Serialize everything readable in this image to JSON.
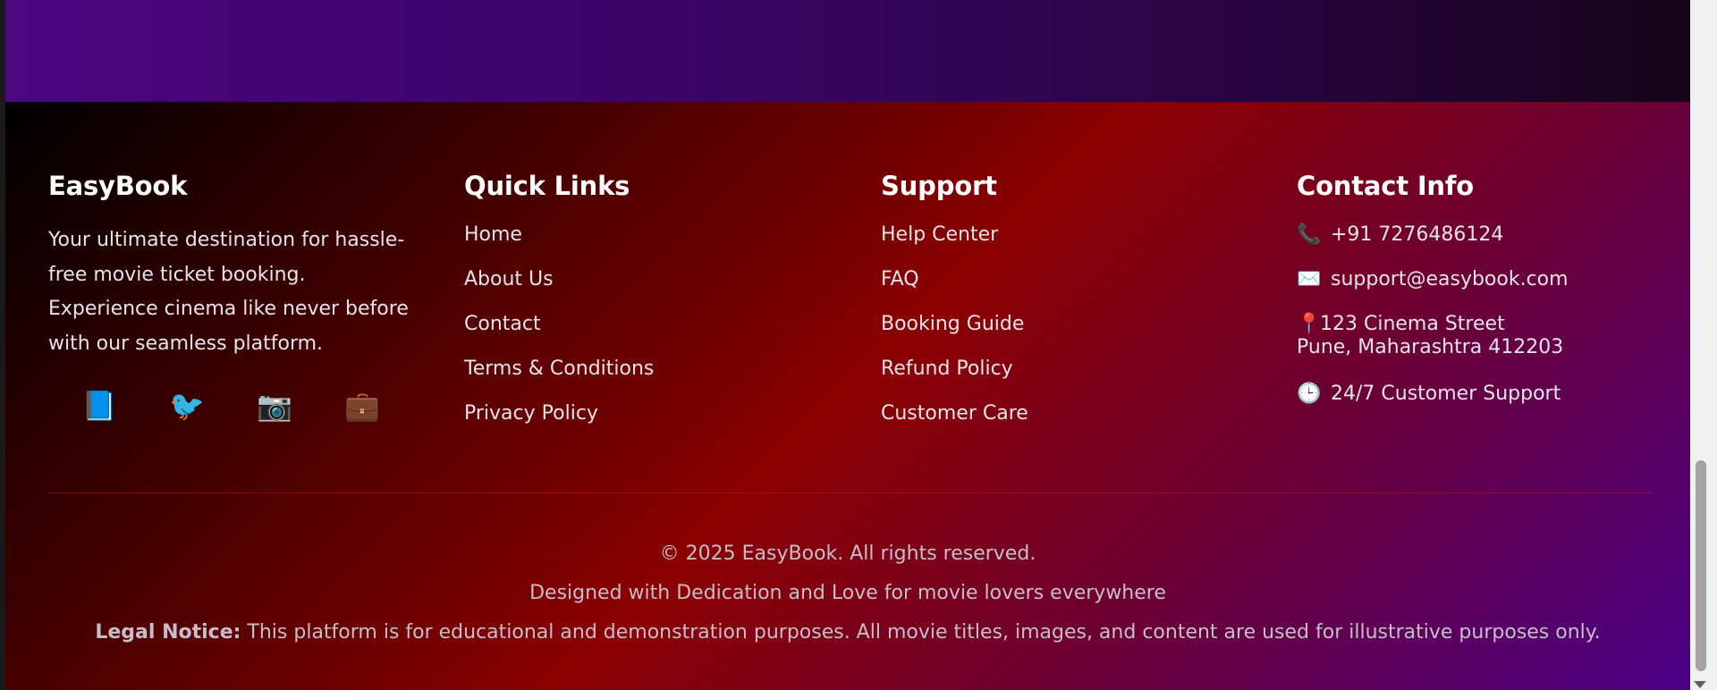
{
  "brand": {
    "title": "EasyBook",
    "description": "Your ultimate destination for hassle-free movie ticket booking. Experience cinema like never before with our seamless platform.",
    "social": [
      {
        "icon": "book-icon",
        "glyph": "📘"
      },
      {
        "icon": "bird-icon",
        "glyph": "🐦"
      },
      {
        "icon": "camera-icon",
        "glyph": "📷"
      },
      {
        "icon": "briefcase-icon",
        "glyph": "💼"
      }
    ]
  },
  "quick_links": {
    "title": "Quick Links",
    "items": [
      "Home",
      "About Us",
      "Contact",
      "Terms & Conditions",
      "Privacy Policy"
    ]
  },
  "support": {
    "title": "Support",
    "items": [
      "Help Center",
      "FAQ",
      "Booking Guide",
      "Refund Policy",
      "Customer Care"
    ]
  },
  "contact": {
    "title": "Contact Info",
    "phone": "+91 7276486124",
    "email": "support@easybook.com",
    "address_line1": "123 Cinema Street",
    "address_line2": "Pune, Maharashtra 412203",
    "hours": "24/7 Customer Support",
    "icons": {
      "phone": "📞",
      "email": "✉️",
      "address": "📍",
      "hours": "🕒"
    }
  },
  "bottom": {
    "copyright": "© 2025 EasyBook. All rights reserved.",
    "designed": "Designed with Dedication and Love for movie lovers everywhere",
    "legal_label": "Legal Notice:",
    "legal_text": " This platform is for educational and demonstration purposes. All movie titles, images, and content are used for illustrative purposes only."
  },
  "colors": {
    "top_gradient": [
      "#4a0780",
      "#150417"
    ],
    "footer_gradient": [
      "#000000",
      "#8b0000",
      "#4a0087"
    ]
  }
}
